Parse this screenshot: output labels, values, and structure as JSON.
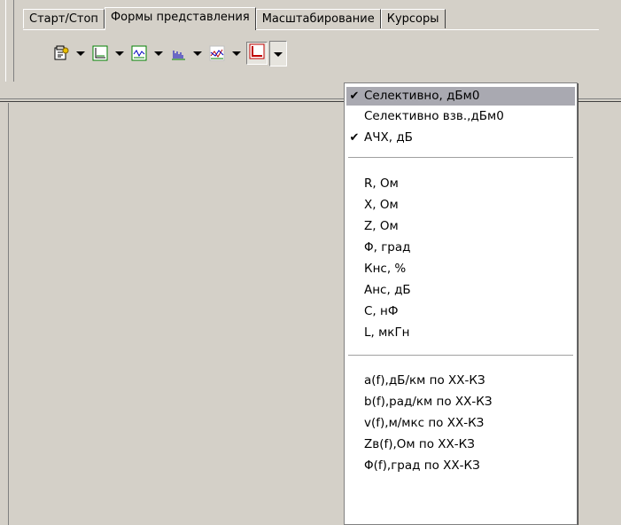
{
  "tabs": [
    "Старт/Стоп",
    "Формы представления",
    "Масштабирование",
    "Курсоры"
  ],
  "active_tab": 1,
  "toolbar": {
    "buttons": [
      {
        "icon": "properties-icon"
      },
      {
        "icon": "graph-icon"
      },
      {
        "icon": "wave-graph-icon"
      },
      {
        "icon": "bar-chart-icon"
      },
      {
        "icon": "multi-graph-icon"
      },
      {
        "icon": "red-graph-icon"
      }
    ]
  },
  "menu": {
    "group1": [
      {
        "label": "Селективно, дБм0",
        "checked": true,
        "highlighted": true
      },
      {
        "label": "Селективно взв.,дБм0",
        "checked": false
      },
      {
        "label": "АЧХ, дБ",
        "checked": true
      }
    ],
    "group2": [
      {
        "label": "R, Ом"
      },
      {
        "label": "X, Ом"
      },
      {
        "label": "Z, Ом"
      },
      {
        "label": "Φ, град"
      },
      {
        "label": "Кнс, %"
      },
      {
        "label": "Анс, дБ"
      },
      {
        "label": "C, нФ"
      },
      {
        "label": "L, мкГн"
      }
    ],
    "group3": [
      {
        "label": "a(f),дБ/км по ХХ-КЗ"
      },
      {
        "label": "b(f),рад/км по ХХ-КЗ"
      },
      {
        "label": "v(f),м/мкс по ХХ-КЗ"
      },
      {
        "label": "Zв(f),Ом по ХХ-КЗ"
      },
      {
        "label": "Φ(f),град по ХХ-КЗ"
      }
    ],
    "check_glyph": "✔"
  }
}
